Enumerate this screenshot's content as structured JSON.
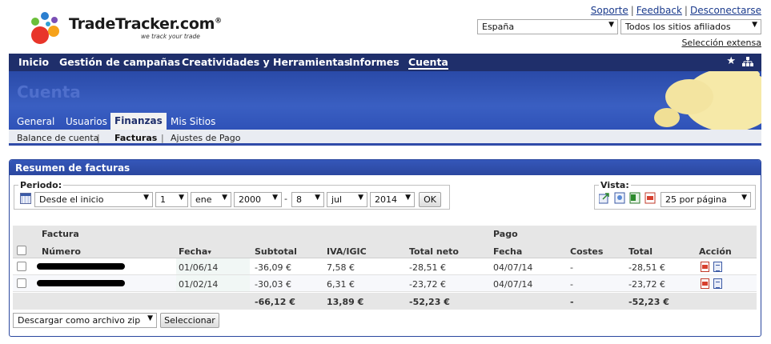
{
  "header": {
    "brand": "TradeTracker.com",
    "brand_mark": "®",
    "tagline": "we track your trade",
    "links": [
      "Soporte",
      "Feedback",
      "Desconectarse"
    ],
    "country_select": "España",
    "sites_select": "Todos los sitios afiliados",
    "extended_selection": "Selección extensa"
  },
  "nav": {
    "items": [
      "Inicio",
      "Gestión de campañas",
      "Creatividades y Herramientas",
      "Informes",
      "Cuenta"
    ],
    "active": "Cuenta"
  },
  "banner": {
    "title": "Cuenta",
    "tabs": [
      "General",
      "Usuarios",
      "Finanzas",
      "Mis Sitios"
    ],
    "active_tab": "Finanzas"
  },
  "subnav": {
    "items": [
      "Balance de cuenta",
      "Facturas",
      "Ajustes de Pago"
    ],
    "active": "Facturas"
  },
  "panel": {
    "title": "Resumen de facturas",
    "periodo": {
      "label": "Periodo:",
      "range": "Desde el inicio",
      "from_day": "1",
      "from_month": "ene",
      "from_year": "2000",
      "dash": "-",
      "to_day": "8",
      "to_month": "jul",
      "to_year": "2014",
      "ok": "OK"
    },
    "vista": {
      "label": "Vista:",
      "per_page": "25 por página"
    },
    "table": {
      "groups": {
        "factura": "Factura",
        "pago": "Pago"
      },
      "columns": [
        "Número",
        "Fecha",
        "Subtotal",
        "IVA/IGIC",
        "Total neto",
        "Fecha",
        "Costes",
        "Total",
        "Acción"
      ],
      "sort_indicator": "▾",
      "rows": [
        {
          "fecha": "01/06/14",
          "subtotal": "-36,09 €",
          "iva": "7,58 €",
          "total_neto": "-28,51 €",
          "pago_fecha": "04/07/14",
          "costes": "-",
          "total": "-28,51 €"
        },
        {
          "fecha": "01/02/14",
          "subtotal": "-30,03 €",
          "iva": "6,31 €",
          "total_neto": "-23,72 €",
          "pago_fecha": "04/07/14",
          "costes": "-",
          "total": "-23,72 €"
        }
      ],
      "totals": {
        "subtotal": "-66,12 €",
        "iva": "13,89 €",
        "total_neto": "-52,23 €",
        "costes": "-",
        "total": "-52,23 €"
      }
    },
    "bulk": {
      "action": "Descargar como archivo zip",
      "button": "Seleccionar"
    }
  },
  "colors": {
    "nav_bg": "#1f2f6b",
    "banner_bg": "#3a5fc2",
    "panel_head": "#2b479f",
    "link": "#1a3a8c"
  }
}
